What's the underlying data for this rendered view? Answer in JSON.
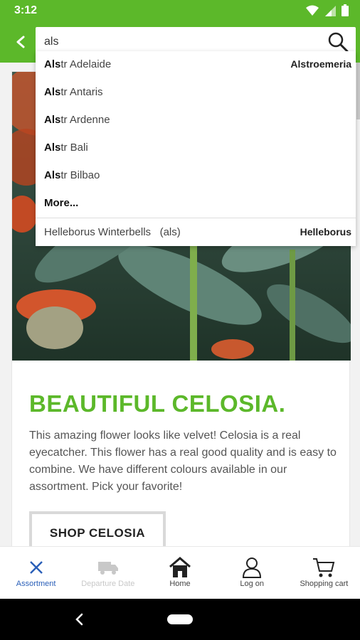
{
  "status_bar": {
    "time": "3:12"
  },
  "search": {
    "query": "als",
    "placeholder": ""
  },
  "suggestions": [
    {
      "match": "Als",
      "rest": "tr Adelaide",
      "category": "Alstroemeria"
    },
    {
      "match": "Als",
      "rest": "tr Antaris",
      "category": ""
    },
    {
      "match": "Als",
      "rest": "tr Ardenne",
      "category": ""
    },
    {
      "match": "Als",
      "rest": "tr Bali",
      "category": ""
    },
    {
      "match": "Als",
      "rest": "tr Bilbao",
      "category": ""
    }
  ],
  "more_label": "More...",
  "extra_suggestion": {
    "label": "Helleborus Winterbells",
    "hint": "(als)",
    "category": "Helleborus"
  },
  "promo": {
    "headline": "BEAUTIFUL CELOSIA.",
    "description": "This amazing flower looks like velvet! Celosia is a real eyecatcher. This flower has a real good quality and is easy to combine. We have different colours available in our assortment. Pick your favorite!",
    "cta": "SHOP CELOSIA"
  },
  "bottom_nav": [
    {
      "label": "Assortment",
      "icon": "close-icon",
      "state": "active"
    },
    {
      "label": "Departure Date",
      "icon": "truck-icon",
      "state": "disabled"
    },
    {
      "label": "Home",
      "icon": "home-icon",
      "state": "normal"
    },
    {
      "label": "Log on",
      "icon": "user-icon",
      "state": "normal"
    },
    {
      "label": "Shopping cart",
      "icon": "cart-icon",
      "state": "normal"
    }
  ],
  "colors": {
    "brand": "#5cb82a",
    "active_nav": "#2a5fb8",
    "disabled": "#c8c8c8"
  }
}
